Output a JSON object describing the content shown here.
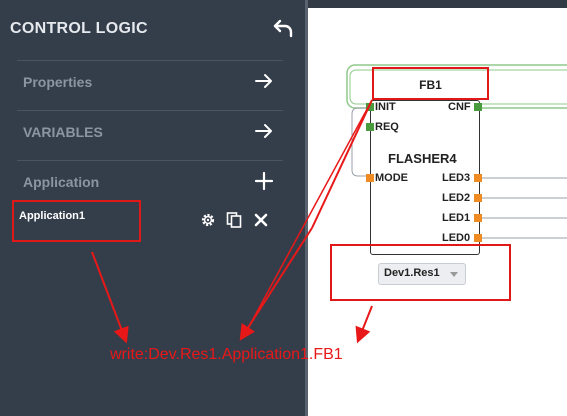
{
  "sidebar": {
    "title": "CONTROL LOGIC",
    "items": [
      {
        "label": "Properties",
        "action": "arrow-right-icon"
      },
      {
        "label": "VARIABLES",
        "action": "arrow-right-icon"
      },
      {
        "label": "Application",
        "action": "plus-icon"
      }
    ],
    "application_item": {
      "label": "Application1",
      "tools": [
        "gear-icon",
        "copy-icon",
        "close-icon"
      ]
    }
  },
  "block": {
    "instance_name": "FB1",
    "type_name": "FLASHER4",
    "event_inputs": [
      "INIT",
      "REQ"
    ],
    "event_outputs": [
      "CNF"
    ],
    "data_inputs": [
      "MODE"
    ],
    "data_outputs": [
      "LED3",
      "LED2",
      "LED1",
      "LED0"
    ]
  },
  "device_select": {
    "value": "Dev1.Res1"
  },
  "annotation": "write:Dev.Res1.Application1.FB1",
  "colors": {
    "sidebar": "#343d4a",
    "event_port": "#4a9a3e",
    "data_port": "#f08a22",
    "highlight": "#e01818",
    "connection": "#8fc88a"
  }
}
